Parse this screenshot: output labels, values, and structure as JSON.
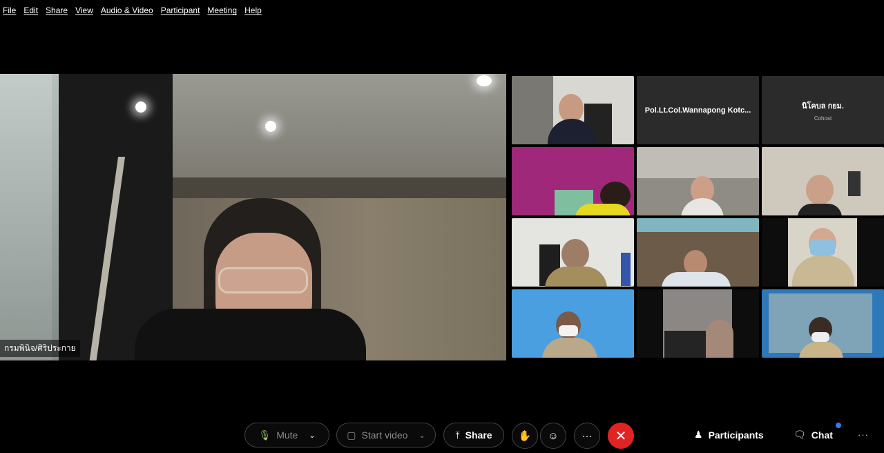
{
  "menu": [
    "File",
    "Edit",
    "Share",
    "View",
    "Audio & Video",
    "Participant",
    "Meeting",
    "Help"
  ],
  "main_video": {
    "name": "กรมพินิจ/ศิริประกาย"
  },
  "gallery": {
    "tiles": [
      {
        "type": "video"
      },
      {
        "type": "name",
        "name": "Pol.Lt.Col.Wannapong Kotc...",
        "role": ""
      },
      {
        "type": "name",
        "name": "นิโคบล กยม.",
        "role": "Cohost"
      },
      {
        "type": "video"
      },
      {
        "type": "video"
      },
      {
        "type": "video"
      },
      {
        "type": "video"
      },
      {
        "type": "video"
      },
      {
        "type": "video"
      },
      {
        "type": "video"
      },
      {
        "type": "video"
      },
      {
        "type": "video"
      }
    ]
  },
  "toolbar": {
    "mute_label": "Mute",
    "start_video_label": "Start video",
    "share_label": "Share",
    "more_label": "···",
    "participants_label": "Participants",
    "chat_label": "Chat",
    "overflow_label": "···"
  },
  "colors": {
    "end_call": "#e02424",
    "chat_dot": "#2f7fe8"
  },
  "icons": [
    "microphone-icon",
    "chevron-down-icon",
    "video-off-icon",
    "share-screen-icon",
    "raise-hand-icon",
    "reaction-icon",
    "more-icon",
    "end-call-icon",
    "participants-icon",
    "chat-icon"
  ]
}
